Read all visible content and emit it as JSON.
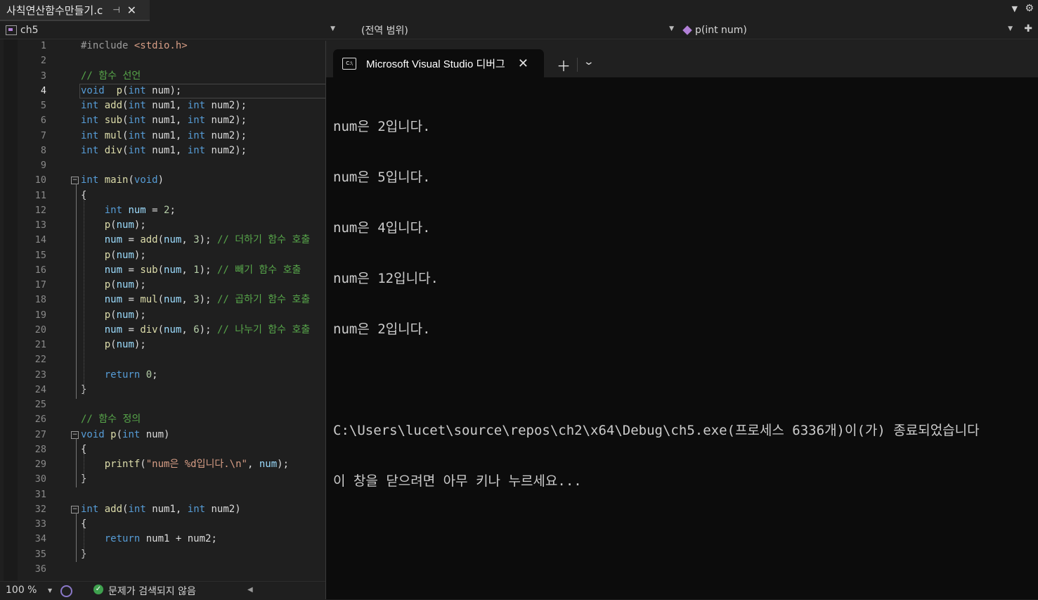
{
  "tab": {
    "file_name": "사칙연산함수만들기.c",
    "pin_glyph": "⊣",
    "close_glyph": "✕"
  },
  "navbar": {
    "project": "ch5",
    "scope": "(전역 범위)",
    "member": "p(int num)"
  },
  "editor": {
    "current_line": 4,
    "lines": [
      {
        "n": "1",
        "tokens": [
          [
            "pp",
            "#include "
          ],
          [
            "inc",
            "<stdio.h>"
          ]
        ]
      },
      {
        "n": "2",
        "tokens": []
      },
      {
        "n": "3",
        "tokens": [
          [
            "cm",
            "// 함수 선언"
          ]
        ]
      },
      {
        "n": "4",
        "tokens": [
          [
            "kw",
            "void"
          ],
          [
            "",
            "  "
          ],
          [
            "fn",
            "p"
          ],
          [
            "",
            "("
          ],
          [
            "kw",
            "int"
          ],
          [
            "",
            " num);"
          ]
        ]
      },
      {
        "n": "5",
        "tokens": [
          [
            "kw",
            "int"
          ],
          [
            "",
            " "
          ],
          [
            "fn",
            "add"
          ],
          [
            "",
            "("
          ],
          [
            "kw",
            "int"
          ],
          [
            "",
            " num1, "
          ],
          [
            "kw",
            "int"
          ],
          [
            "",
            " num2);"
          ]
        ]
      },
      {
        "n": "6",
        "tokens": [
          [
            "kw",
            "int"
          ],
          [
            "",
            " "
          ],
          [
            "fn",
            "sub"
          ],
          [
            "",
            "("
          ],
          [
            "kw",
            "int"
          ],
          [
            "",
            " num1, "
          ],
          [
            "kw",
            "int"
          ],
          [
            "",
            " num2);"
          ]
        ]
      },
      {
        "n": "7",
        "tokens": [
          [
            "kw",
            "int"
          ],
          [
            "",
            " "
          ],
          [
            "fn",
            "mul"
          ],
          [
            "",
            "("
          ],
          [
            "kw",
            "int"
          ],
          [
            "",
            " num1, "
          ],
          [
            "kw",
            "int"
          ],
          [
            "",
            " num2);"
          ]
        ]
      },
      {
        "n": "8",
        "tokens": [
          [
            "kw",
            "int"
          ],
          [
            "",
            " "
          ],
          [
            "fn",
            "div"
          ],
          [
            "",
            "("
          ],
          [
            "kw",
            "int"
          ],
          [
            "",
            " num1, "
          ],
          [
            "kw",
            "int"
          ],
          [
            "",
            " num2);"
          ]
        ]
      },
      {
        "n": "9",
        "tokens": []
      },
      {
        "n": "10",
        "fold": true,
        "tokens": [
          [
            "kw",
            "int"
          ],
          [
            "",
            " "
          ],
          [
            "fn",
            "main"
          ],
          [
            "",
            "("
          ],
          [
            "kw",
            "void"
          ],
          [
            "",
            ")"
          ]
        ]
      },
      {
        "n": "11",
        "tokens": [
          [
            "",
            "{"
          ]
        ]
      },
      {
        "n": "12",
        "tokens": [
          [
            "",
            "    "
          ],
          [
            "kw",
            "int"
          ],
          [
            "",
            " "
          ],
          [
            "pl",
            "num"
          ],
          [
            "",
            " = "
          ],
          [
            "num",
            "2"
          ],
          [
            "",
            ";"
          ]
        ]
      },
      {
        "n": "13",
        "tokens": [
          [
            "",
            "    "
          ],
          [
            "fn",
            "p"
          ],
          [
            "",
            "("
          ],
          [
            "pl",
            "num"
          ],
          [
            "",
            ");"
          ]
        ]
      },
      {
        "n": "14",
        "tokens": [
          [
            "",
            "    "
          ],
          [
            "pl",
            "num"
          ],
          [
            "",
            " = "
          ],
          [
            "fn",
            "add"
          ],
          [
            "",
            "("
          ],
          [
            "pl",
            "num"
          ],
          [
            "",
            ", "
          ],
          [
            "num",
            "3"
          ],
          [
            "",
            "); "
          ],
          [
            "cm",
            "// 더하기 함수 호출"
          ]
        ]
      },
      {
        "n": "15",
        "tokens": [
          [
            "",
            "    "
          ],
          [
            "fn",
            "p"
          ],
          [
            "",
            "("
          ],
          [
            "pl",
            "num"
          ],
          [
            "",
            ");"
          ]
        ]
      },
      {
        "n": "16",
        "tokens": [
          [
            "",
            "    "
          ],
          [
            "pl",
            "num"
          ],
          [
            "",
            " = "
          ],
          [
            "fn",
            "sub"
          ],
          [
            "",
            "("
          ],
          [
            "pl",
            "num"
          ],
          [
            "",
            ", "
          ],
          [
            "num",
            "1"
          ],
          [
            "",
            "); "
          ],
          [
            "cm",
            "// 빼기 함수 호출"
          ]
        ]
      },
      {
        "n": "17",
        "tokens": [
          [
            "",
            "    "
          ],
          [
            "fn",
            "p"
          ],
          [
            "",
            "("
          ],
          [
            "pl",
            "num"
          ],
          [
            "",
            ");"
          ]
        ]
      },
      {
        "n": "18",
        "tokens": [
          [
            "",
            "    "
          ],
          [
            "pl",
            "num"
          ],
          [
            "",
            " = "
          ],
          [
            "fn",
            "mul"
          ],
          [
            "",
            "("
          ],
          [
            "pl",
            "num"
          ],
          [
            "",
            ", "
          ],
          [
            "num",
            "3"
          ],
          [
            "",
            "); "
          ],
          [
            "cm",
            "// 곱하기 함수 호출"
          ]
        ]
      },
      {
        "n": "19",
        "tokens": [
          [
            "",
            "    "
          ],
          [
            "fn",
            "p"
          ],
          [
            "",
            "("
          ],
          [
            "pl",
            "num"
          ],
          [
            "",
            ");"
          ]
        ]
      },
      {
        "n": "20",
        "tokens": [
          [
            "",
            "    "
          ],
          [
            "pl",
            "num"
          ],
          [
            "",
            " = "
          ],
          [
            "fn",
            "div"
          ],
          [
            "",
            "("
          ],
          [
            "pl",
            "num"
          ],
          [
            "",
            ", "
          ],
          [
            "num",
            "6"
          ],
          [
            "",
            "); "
          ],
          [
            "cm",
            "// 나누기 함수 호출"
          ]
        ]
      },
      {
        "n": "21",
        "tokens": [
          [
            "",
            "    "
          ],
          [
            "fn",
            "p"
          ],
          [
            "",
            "("
          ],
          [
            "pl",
            "num"
          ],
          [
            "",
            ");"
          ]
        ]
      },
      {
        "n": "22",
        "tokens": []
      },
      {
        "n": "23",
        "tokens": [
          [
            "",
            "    "
          ],
          [
            "kw",
            "return"
          ],
          [
            "",
            " "
          ],
          [
            "num",
            "0"
          ],
          [
            "",
            ";"
          ]
        ]
      },
      {
        "n": "24",
        "tokens": [
          [
            "",
            "}"
          ]
        ]
      },
      {
        "n": "25",
        "tokens": []
      },
      {
        "n": "26",
        "tokens": [
          [
            "cm",
            "// 함수 정의"
          ]
        ]
      },
      {
        "n": "27",
        "fold": true,
        "tokens": [
          [
            "kw",
            "void"
          ],
          [
            "",
            " "
          ],
          [
            "fn",
            "p"
          ],
          [
            "",
            "("
          ],
          [
            "kw",
            "int"
          ],
          [
            "",
            " num)"
          ]
        ]
      },
      {
        "n": "28",
        "tokens": [
          [
            "",
            "{"
          ]
        ]
      },
      {
        "n": "29",
        "tokens": [
          [
            "",
            "    "
          ],
          [
            "fn",
            "printf"
          ],
          [
            "",
            "("
          ],
          [
            "str",
            "\"num은 %d입니다.\\n\""
          ],
          [
            "",
            ", "
          ],
          [
            "pl",
            "num"
          ],
          [
            "",
            ");"
          ]
        ]
      },
      {
        "n": "30",
        "tokens": [
          [
            "",
            "}"
          ]
        ]
      },
      {
        "n": "31",
        "tokens": []
      },
      {
        "n": "32",
        "fold": true,
        "tokens": [
          [
            "kw",
            "int"
          ],
          [
            "",
            " "
          ],
          [
            "fn",
            "add"
          ],
          [
            "",
            "("
          ],
          [
            "kw",
            "int"
          ],
          [
            "",
            " num1, "
          ],
          [
            "kw",
            "int"
          ],
          [
            "",
            " num2)"
          ]
        ]
      },
      {
        "n": "33",
        "tokens": [
          [
            "",
            "{"
          ]
        ]
      },
      {
        "n": "34",
        "tokens": [
          [
            "",
            "    "
          ],
          [
            "kw",
            "return"
          ],
          [
            "",
            " num1 + num2;"
          ]
        ]
      },
      {
        "n": "35",
        "tokens": [
          [
            "",
            "}"
          ]
        ]
      },
      {
        "n": "36",
        "tokens": []
      }
    ]
  },
  "statusbar": {
    "zoom": "100 %",
    "issues": "문제가 검색되지 않음"
  },
  "terminal": {
    "tab_title": "Microsoft Visual Studio 디버그",
    "icon_text": "C:\\",
    "output": [
      "num은 2입니다.",
      "num은 5입니다.",
      "num은 4입니다.",
      "num은 12입니다.",
      "num은 2입니다.",
      "",
      "C:\\Users\\lucet\\source\\repos\\ch2\\x64\\Debug\\ch5.exe(프로세스 6336개)이(가) 종료되었습니다",
      "이 창을 닫으려면 아무 키나 누르세요..."
    ]
  },
  "colors": {
    "keyword": "#569cd6",
    "function": "#dcdcaa",
    "comment": "#57a64a",
    "string": "#d69d85",
    "number": "#b5cea8",
    "editor_bg": "#1f1f1f",
    "terminal_bg": "#0c0c0c"
  }
}
